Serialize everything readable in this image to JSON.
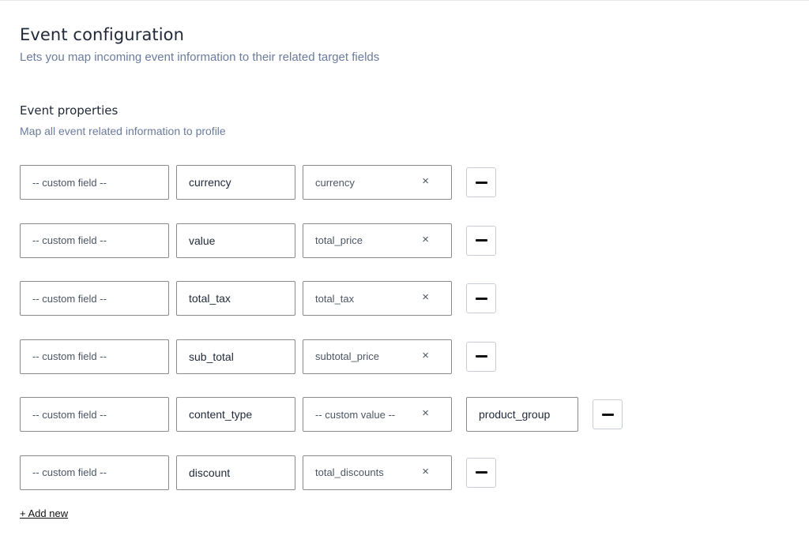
{
  "header": {
    "title": "Event configuration",
    "subtitle": "Lets you map incoming event information to their related target fields"
  },
  "section": {
    "title": "Event properties",
    "subtitle": "Map all event related information to profile"
  },
  "icons": {
    "clear": "×",
    "remove": "minus-icon"
  },
  "rows": [
    {
      "source": "-- custom field --",
      "key": "currency",
      "target": "currency",
      "custom": null
    },
    {
      "source": "-- custom field --",
      "key": "value",
      "target": "total_price",
      "custom": null
    },
    {
      "source": "-- custom field --",
      "key": "total_tax",
      "target": "total_tax",
      "custom": null
    },
    {
      "source": "-- custom field --",
      "key": "sub_total",
      "target": "subtotal_price",
      "custom": null
    },
    {
      "source": "-- custom field --",
      "key": "content_type",
      "target": "-- custom value --",
      "custom": "product_group"
    },
    {
      "source": "-- custom field --",
      "key": "discount",
      "target": "total_discounts",
      "custom": null
    }
  ],
  "actions": {
    "add_new": "+ Add new"
  }
}
